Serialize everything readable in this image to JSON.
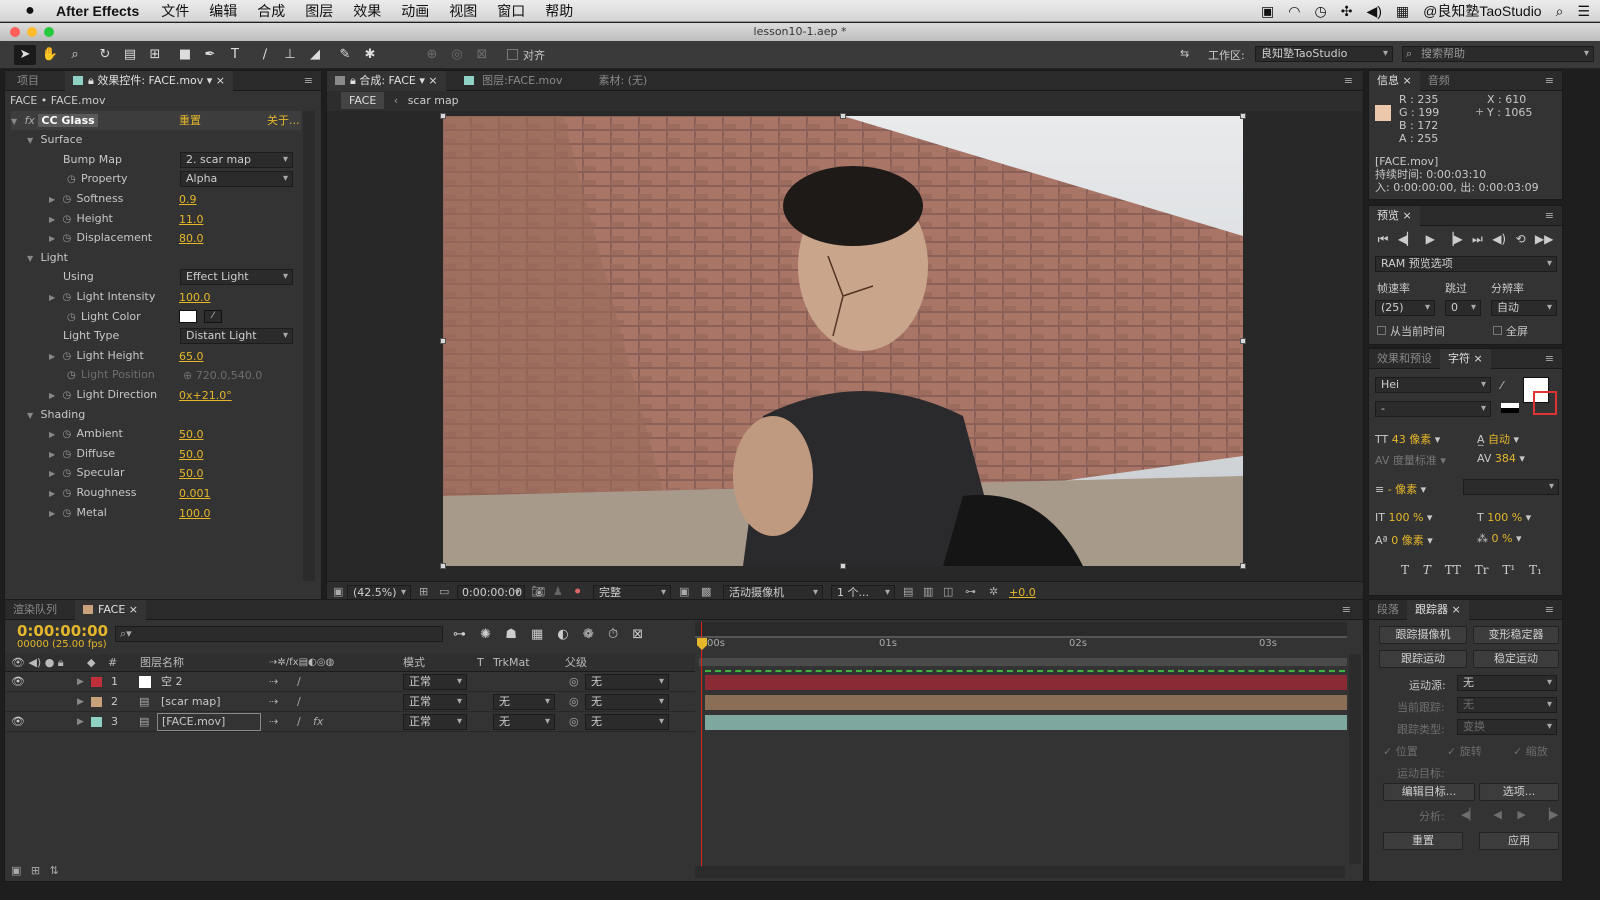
{
  "menubar": {
    "app_name": "After Effects",
    "menus": [
      "文件",
      "编辑",
      "合成",
      "图层",
      "效果",
      "动画",
      "视图",
      "窗口",
      "帮助"
    ],
    "user": "@良知塾TaoStudio"
  },
  "window": {
    "title": "lesson10-1.aep *"
  },
  "toolbar": {
    "align_label": "对齐",
    "workspace_label": "工作区:",
    "workspace_value": "良知塾TaoStudio",
    "search_placeholder": "搜索帮助"
  },
  "project_panel": {
    "tab_project": "项目",
    "tab_effects": "效果控件: FACE.mov",
    "breadcrumb": "FACE • FACE.mov"
  },
  "effect": {
    "name": "CC Glass",
    "reset": "重置",
    "about": "关于...",
    "surface": "Surface",
    "bump_map_label": "Bump Map",
    "bump_map_value": "2. scar map",
    "property_label": "Property",
    "property_value": "Alpha",
    "softness_label": "Softness",
    "softness_value": "0.9",
    "height_label": "Height",
    "height_value": "11.0",
    "displacement_label": "Displacement",
    "displacement_value": "80.0",
    "light": "Light",
    "using_label": "Using",
    "using_value": "Effect Light",
    "light_intensity_label": "Light Intensity",
    "light_intensity_value": "100.0",
    "light_color_label": "Light Color",
    "light_type_label": "Light Type",
    "light_type_value": "Distant Light",
    "light_height_label": "Light Height",
    "light_height_value": "65.0",
    "light_position_label": "Light Position",
    "light_position_value": "720.0,540.0",
    "light_direction_label": "Light Direction",
    "light_direction_value": "0x+21.0°",
    "shading": "Shading",
    "ambient_label": "Ambient",
    "ambient_value": "50.0",
    "diffuse_label": "Diffuse",
    "diffuse_value": "50.0",
    "specular_label": "Specular",
    "specular_value": "50.0",
    "roughness_label": "Roughness",
    "roughness_value": "0.001",
    "metal_label": "Metal",
    "metal_value": "100.0"
  },
  "comp_viewer": {
    "tab_comp": "合成: FACE",
    "tab_layer": "图层:FACE.mov",
    "tab_footage": "素材: (无)",
    "crumb1": "FACE",
    "crumb2": "scar map",
    "zoom": "(42.5%)",
    "timecode": "0:00:00:00",
    "quality": "完整",
    "camera": "活动摄像机",
    "views": "1 个...",
    "exposure": "+0.0"
  },
  "info_panel": {
    "tab_info": "信息",
    "tab_audio": "音频",
    "r": "R : 235",
    "g": "G : 199",
    "b": "B : 172",
    "a": "A : 255",
    "x": "X : 610",
    "y": "Y : 1065",
    "file": "[FACE.mov]",
    "duration": "持续时间: 0:00:03:10",
    "inout": "入: 0:00:00:00, 出: 0:00:03:09",
    "swatch_color": "#ebc7ac"
  },
  "preview_panel": {
    "tab": "预览",
    "ram": "RAM 预览选项",
    "fps_label": "帧速率",
    "skip_label": "跳过",
    "res_label": "分辨率",
    "fps_value": "(25)",
    "skip_value": "0",
    "res_value": "自动",
    "from_current": "从当前时间",
    "fullscreen": "全屏"
  },
  "char_panel": {
    "tab_effects": "效果和预设",
    "tab_char": "字符",
    "font": "Hei",
    "style": "-",
    "size": "43 像素",
    "leading": "自动",
    "kerning": "度量标准",
    "tracking": "384",
    "stroke": "- 像素",
    "vscale": "100 %",
    "hscale": "100 %",
    "baseline": "0 像素",
    "tsume": "0 %",
    "styles": [
      "T",
      "T",
      "TT",
      "Tr",
      "T¹",
      "T₁"
    ]
  },
  "tracker_panel": {
    "tab_para": "段落",
    "tab_tracker": "跟踪器",
    "track_camera": "跟踪摄像机",
    "warp_stab": "变形稳定器",
    "track_motion": "跟踪运动",
    "stabilize": "稳定运动",
    "source_label": "运动源:",
    "source_value": "无",
    "current_track": "当前跟踪:",
    "current_track_value": "无",
    "track_type": "跟踪类型:",
    "track_type_value": "变换",
    "position": "位置",
    "rotation": "旋转",
    "scale": "缩放",
    "target": "运动目标:",
    "edit_target": "编辑目标...",
    "options": "选项...",
    "analyze": "分析:",
    "reset": "重置",
    "apply": "应用"
  },
  "timeline": {
    "tab_render": "渲染队列",
    "tab_comp": "FACE",
    "timecode": "0:00:00:00",
    "frames": "00000 (25.00 fps)",
    "col_name": "图层名称",
    "col_mode": "模式",
    "col_t": "T",
    "col_trkmat": "TrkMat",
    "col_parent": "父级",
    "ruler": [
      "00s",
      "01s",
      "02s",
      "03s"
    ],
    "layers": [
      {
        "num": "1",
        "name": "空 2",
        "mode": "正常",
        "trkmat": "",
        "parent": "无",
        "color": "#c0303a",
        "bar": "#8a2a35"
      },
      {
        "num": "2",
        "name": "[scar map]",
        "mode": "正常",
        "trkmat": "无",
        "parent": "无",
        "color": "#c8a27a",
        "bar": "#8a6e55"
      },
      {
        "num": "3",
        "name": "[FACE.mov]",
        "mode": "正常",
        "trkmat": "无",
        "parent": "无",
        "color": "#8fd1c4",
        "bar": "#7ea89f"
      }
    ]
  }
}
